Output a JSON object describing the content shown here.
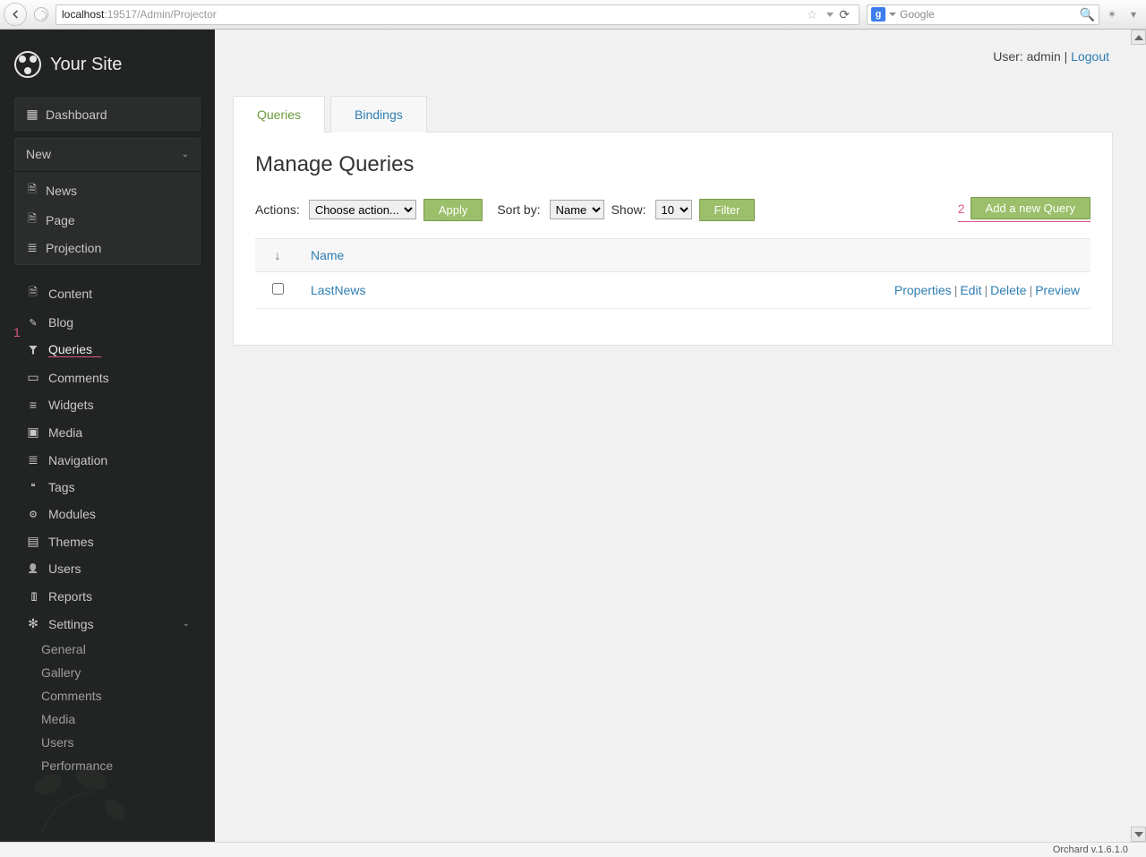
{
  "browser": {
    "url_strong": "localhost",
    "url_dim": ":19517/Admin/Projector",
    "search_engine": "g",
    "search_placeholder": "Google"
  },
  "brand": {
    "title": "Your Site"
  },
  "nav": {
    "dashboard": "Dashboard",
    "new": "New",
    "new_items": [
      "News",
      "Page",
      "Projection"
    ],
    "items": [
      {
        "id": "content",
        "label": "Content",
        "icon": "i-doc"
      },
      {
        "id": "blog",
        "label": "Blog",
        "icon": "i-blog"
      },
      {
        "id": "queries",
        "label": "Queries",
        "icon": "i-funnel",
        "active": true
      },
      {
        "id": "comments",
        "label": "Comments",
        "icon": "i-comment"
      },
      {
        "id": "widgets",
        "label": "Widgets",
        "icon": "i-widget"
      },
      {
        "id": "media",
        "label": "Media",
        "icon": "i-media"
      },
      {
        "id": "navigation",
        "label": "Navigation",
        "icon": "i-nav"
      },
      {
        "id": "tags",
        "label": "Tags",
        "icon": "i-tag"
      },
      {
        "id": "modules",
        "label": "Modules",
        "icon": "i-mod"
      },
      {
        "id": "themes",
        "label": "Themes",
        "icon": "i-theme"
      },
      {
        "id": "users",
        "label": "Users",
        "icon": "i-user"
      },
      {
        "id": "reports",
        "label": "Reports",
        "icon": "i-report"
      },
      {
        "id": "settings",
        "label": "Settings",
        "icon": "i-gear",
        "expandable": true
      }
    ],
    "settings_sub": [
      "General",
      "Gallery",
      "Comments",
      "Media",
      "Users",
      "Performance"
    ]
  },
  "header": {
    "user_prefix": "User: ",
    "user_name": "admin",
    "logout": "Logout"
  },
  "tabs": {
    "queries": "Queries",
    "bindings": "Bindings"
  },
  "page": {
    "title": "Manage Queries",
    "actions_label": "Actions:",
    "action_select": "Choose action...",
    "apply": "Apply",
    "sort_label": "Sort by:",
    "sort_value": "Name",
    "show_label": "Show:",
    "show_value": "10",
    "filter": "Filter",
    "add_new": "Add a new Query",
    "annot1": "1",
    "annot2": "2"
  },
  "table": {
    "col_sort": "↓",
    "col_name": "Name",
    "rows": [
      {
        "name": "LastNews"
      }
    ],
    "actions": {
      "properties": "Properties",
      "edit": "Edit",
      "delete": "Delete",
      "preview": "Preview"
    }
  },
  "footer": {
    "version": "Orchard v.1.6.1.0"
  }
}
